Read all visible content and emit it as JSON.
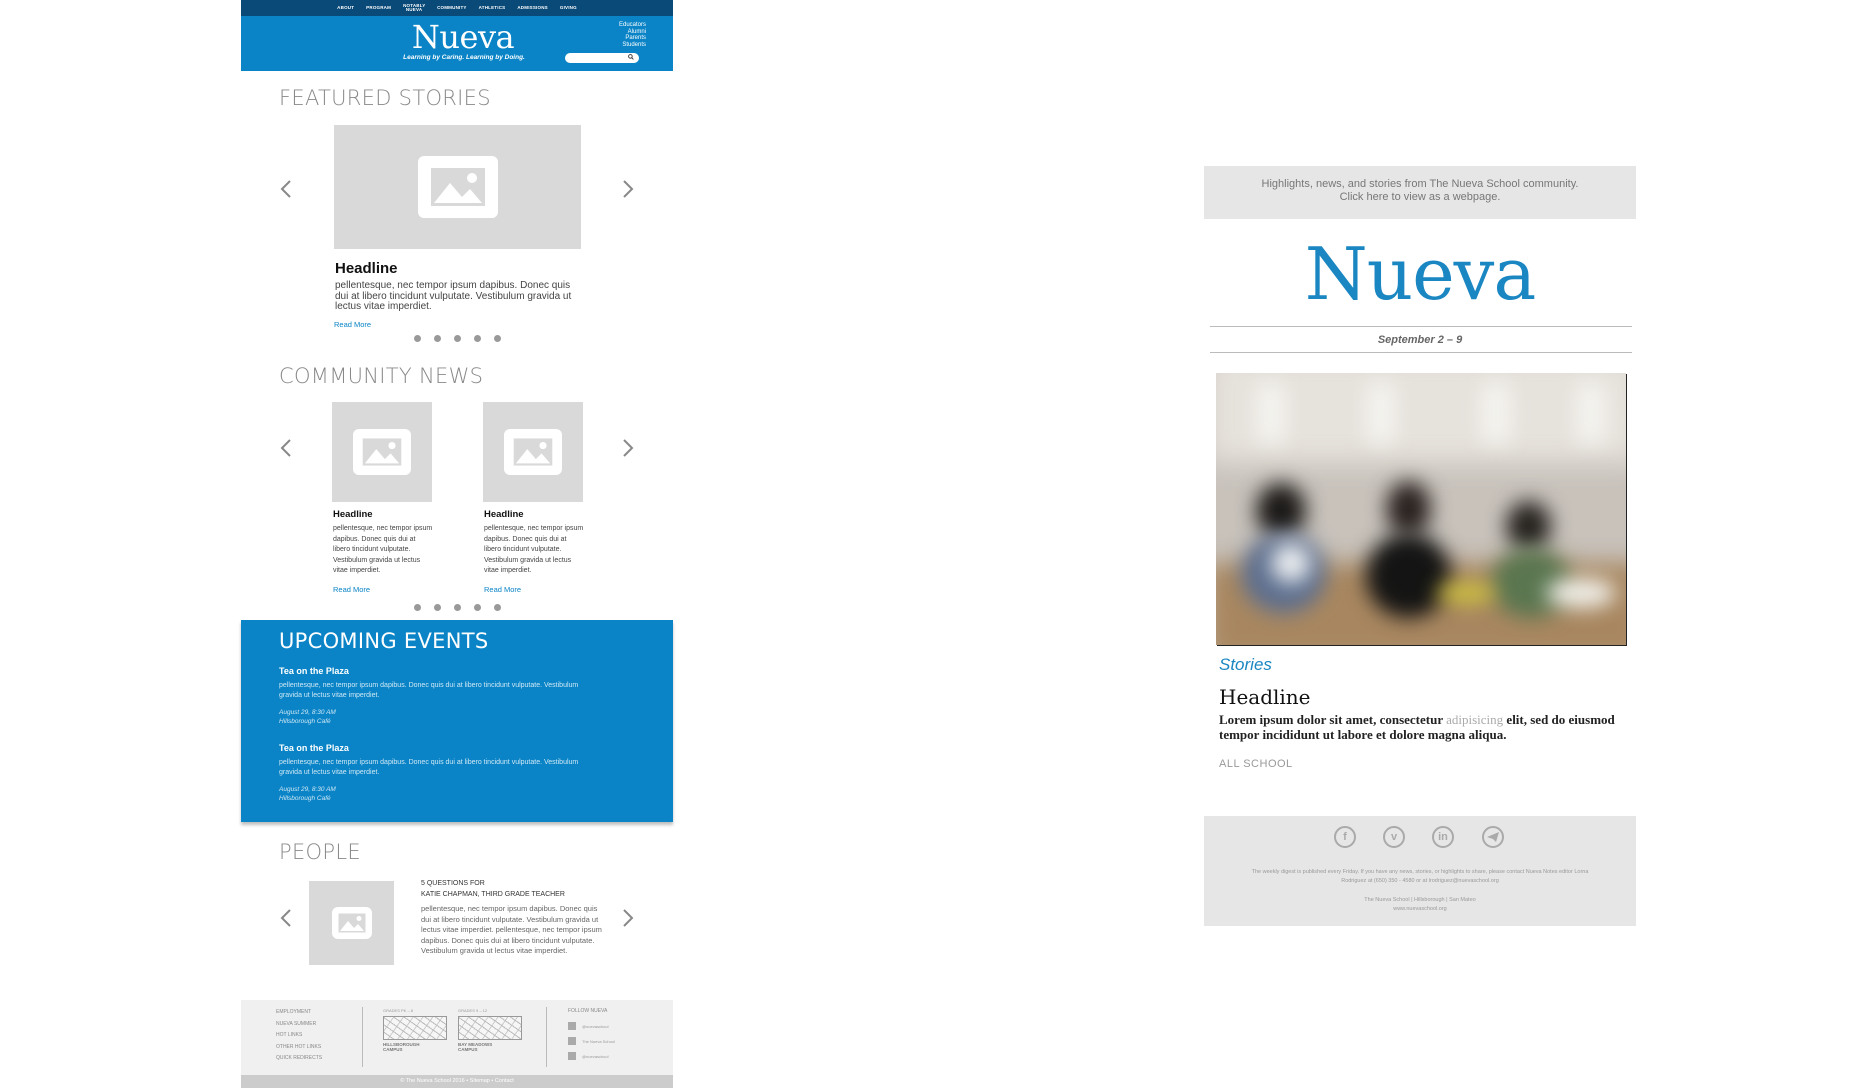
{
  "site": {
    "nav": [
      "ABOUT",
      "PROGRAM",
      "NOTABLY NUEVA",
      "COMMUNITY",
      "ATHLETICS",
      "ADMISSIONS",
      "GIVING"
    ],
    "logo": "Nueva",
    "tagline": "Learning by Caring. Learning by Doing.",
    "audience_links": [
      "Educators",
      "Alumni",
      "Parents",
      "Students"
    ],
    "featured": {
      "heading": "FEATURED STORIES",
      "headline": "Headline",
      "body": "pellentesque, nec tempor ipsum dapibus. Donec quis dui at libero tincidunt vulputate. Vestibulum gravida ut lectus vitae imperdiet.",
      "read_more": "Read More"
    },
    "community": {
      "heading": "COMMUNITY NEWS",
      "items": [
        {
          "headline": "Headline",
          "body": "pellentesque, nec tempor ipsum dapibus. Donec quis dui at libero tincidunt vulputate. Vestibulum gravida ut lectus vitae imperdiet.",
          "read_more": "Read More"
        },
        {
          "headline": "Headline",
          "body": "pellentesque, nec tempor ipsum dapibus. Donec quis dui at libero tincidunt vulputate. Vestibulum gravida ut lectus vitae imperdiet.",
          "read_more": "Read More"
        }
      ]
    },
    "events": {
      "heading": "UPCOMING EVENTS",
      "items": [
        {
          "title": "Tea on the Plaza",
          "body": "pellentesque, nec tempor ipsum dapibus. Donec quis dui at libero tincidunt vulputate. Vestibulum gravida ut lectus vitae imperdiet.",
          "date": "August 29, 8:30 AM",
          "location": "Hillsborough Café"
        },
        {
          "title": "Tea on the Plaza",
          "body": "pellentesque, nec tempor ipsum dapibus. Donec quis dui at libero tincidunt vulputate. Vestibulum gravida ut lectus vitae imperdiet.",
          "date": "August 29, 8:30 AM",
          "location": "Hillsborough Café"
        }
      ]
    },
    "people": {
      "heading": "PEOPLE",
      "kicker": "5 QUESTIONS FOR",
      "name": "KATIE CHAPMAN, THIRD GRADE TEACHER",
      "body": "pellentesque, nec tempor ipsum dapibus. Donec quis dui at libero tincidunt vulputate. Vestibulum gravida ut lectus vitae imperdiet.  pellentesque, nec tempor ipsum dapibus. Donec quis dui at libero tincidunt vulputate. Vestibulum gravida ut lectus vitae imperdiet."
    },
    "footer": {
      "links": [
        "EMPLOYMENT",
        "NUEVA SUMMER",
        "HOT LINKS",
        "OTHER HOT LINKS",
        "QUICK REDIRECTS"
      ],
      "campus1_grade": "GRADES PK – 8",
      "campus1_name": "HILLSBOROUGH CAMPUS",
      "campus2_grade": "GRADES 9 – 12",
      "campus2_name": "BAY MEADOWS CAMPUS",
      "follow": "FOLLOW NUEVA",
      "social": [
        "@nuevaschool",
        "The Nueva School",
        "@nuevaschool"
      ],
      "copyright": "© The Nueva School 2016  •  Sitemap  •  Contact"
    }
  },
  "email": {
    "preheader_line1": "Highlights, news, and stories from The Nueva School community.",
    "preheader_line2": "Click here to view as a webpage.",
    "logo": "Nueva",
    "date": "September 2 – 9",
    "section": "Stories",
    "headline": "Headline",
    "body_a": "Lorem ipsum dolor sit amet, consectetur ",
    "body_muted": "adipisicing",
    "body_b": " elit, sed do eiusmod tempor incididunt ut labore et dolore magna aliqua.",
    "category": "ALL SCHOOL",
    "social_icons": [
      "facebook-icon",
      "vimeo-icon",
      "linkedin-icon",
      "telegram-icon"
    ],
    "footer_note": "The weekly digest is published every Friday. If you have any news, stories, or highlights to share, please contact Nueva Notes editor Lorna Rodriguez at (650) 350 - 4580 or at lrodriguez@nuevaschool.org",
    "footer_address": "The Nueva School  |  Hillsborough  |  San Mateo",
    "footer_url": "www.nuevaschool.org"
  }
}
